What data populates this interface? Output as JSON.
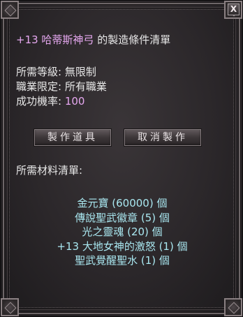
{
  "window": {
    "close_label": "X"
  },
  "title": {
    "item_name": "+13 哈蒂斯神弓",
    "suffix": " 的製造條件清單"
  },
  "conditions": [
    {
      "label": "所需等級: ",
      "value": "無限制"
    },
    {
      "label": "職業限定: ",
      "value": "所有職業"
    },
    {
      "label": "成功機率: ",
      "value": "100"
    }
  ],
  "buttons": {
    "make": "製作道具",
    "cancel": "取消製作"
  },
  "materials_title": "所需材料清單:",
  "materials": [
    "金元寶 (60000) 個",
    "傳說聖武徽章 (5) 個",
    "光之靈魂 (20) 個",
    "+13 大地女神的激怒 (1) 個",
    "聖武覺醒聖水 (1) 個"
  ],
  "colors": {
    "item_highlight": "#e6a8f0",
    "material_text": "#a9e7f0",
    "normal_text": "#e8e8e8"
  }
}
